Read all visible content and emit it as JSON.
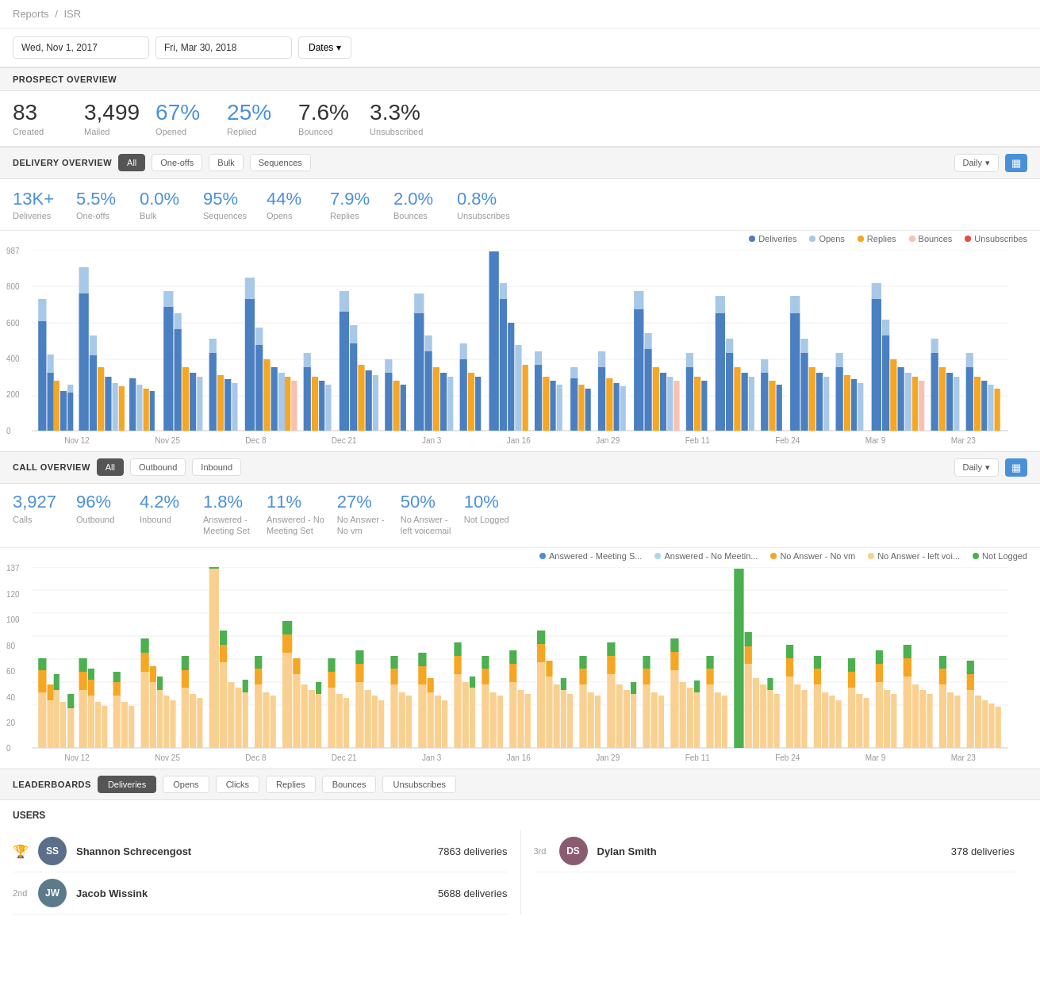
{
  "breadcrumb": {
    "parent": "Reports",
    "separator": "/",
    "current": "ISR"
  },
  "dateRange": {
    "startDate": "Wed, Nov 1, 2017",
    "endDate": "Fri, Mar 30, 2018",
    "datesLabel": "Dates"
  },
  "prospectOverview": {
    "title": "PROSPECT OVERVIEW",
    "metrics": [
      {
        "value": "83",
        "label": "Created"
      },
      {
        "value": "3,499",
        "label": "Mailed"
      },
      {
        "value": "67%",
        "label": "Opened"
      },
      {
        "value": "25%",
        "label": "Replied"
      },
      {
        "value": "7.6%",
        "label": "Bounced"
      },
      {
        "value": "3.3%",
        "label": "Unsubscribed"
      }
    ]
  },
  "deliveryOverview": {
    "title": "DELIVERY OVERVIEW",
    "tabs": [
      "All",
      "One-offs",
      "Bulk",
      "Sequences"
    ],
    "activeTab": "All",
    "timeFilter": "Daily",
    "metrics": [
      {
        "value": "13K+",
        "label": "Deliveries"
      },
      {
        "value": "5.5%",
        "label": "One-offs"
      },
      {
        "value": "0.0%",
        "label": "Bulk"
      },
      {
        "value": "95%",
        "label": "Sequences"
      },
      {
        "value": "44%",
        "label": "Opens"
      },
      {
        "value": "7.9%",
        "label": "Replies"
      },
      {
        "value": "2.0%",
        "label": "Bounces"
      },
      {
        "value": "0.8%",
        "label": "Unsubscribes"
      }
    ],
    "legend": [
      {
        "label": "Deliveries",
        "color": "#4a7fc1"
      },
      {
        "label": "Opens",
        "color": "#a8c8e8"
      },
      {
        "label": "Replies",
        "color": "#f5a623"
      },
      {
        "label": "Bounces",
        "color": "#f9d0c0"
      },
      {
        "label": "Unsubscribes",
        "color": "#e74c3c"
      }
    ],
    "xLabels": [
      "Nov 12",
      "Nov 25",
      "Dec 8",
      "Dec 21",
      "Jan 3",
      "Jan 16",
      "Jan 29",
      "Feb 11",
      "Feb 24",
      "Mar 9",
      "Mar 23"
    ],
    "yMax": 987,
    "yLabels": [
      "987",
      "800",
      "600",
      "400",
      "200",
      "0"
    ]
  },
  "callOverview": {
    "title": "CALL OVERVIEW",
    "tabs": [
      "All",
      "Outbound",
      "Inbound"
    ],
    "activeTab": "All",
    "timeFilter": "Daily",
    "metrics": [
      {
        "value": "3,927",
        "label": "Calls"
      },
      {
        "value": "96%",
        "label": "Outbound"
      },
      {
        "value": "4.2%",
        "label": "Inbound"
      },
      {
        "value": "1.8%",
        "label": "Answered -\nMeeting Set"
      },
      {
        "value": "11%",
        "label": "Answered - No\nMeeting Set"
      },
      {
        "value": "27%",
        "label": "No Answer -\nNo vm"
      },
      {
        "value": "50%",
        "label": "No Answer -\nleft voicemail"
      },
      {
        "value": "10%",
        "label": "Not Logged"
      }
    ],
    "legend": [
      {
        "label": "Answered - Meeting S...",
        "color": "#4a90d9"
      },
      {
        "label": "Answered - No Meetin...",
        "color": "#a8d8f0"
      },
      {
        "label": "No Answer - No vm",
        "color": "#f5a623"
      },
      {
        "label": "No Answer - left voi...",
        "color": "#f9d090"
      },
      {
        "label": "Not Logged",
        "color": "#4caf50"
      }
    ],
    "xLabels": [
      "Nov 12",
      "Nov 25",
      "Dec 8",
      "Dec 21",
      "Jan 3",
      "Jan 16",
      "Jan 29",
      "Feb 11",
      "Feb 24",
      "Mar 9",
      "Mar 23"
    ],
    "yMax": 137,
    "yLabels": [
      "137",
      "120",
      "100",
      "80",
      "60",
      "40",
      "20",
      "0"
    ]
  },
  "leaderboards": {
    "title": "LEADERBOARDS",
    "tabs": [
      "Deliveries",
      "Opens",
      "Clicks",
      "Replies",
      "Bounces",
      "Unsubscribes"
    ],
    "activeTab": "Deliveries",
    "usersTitle": "USERS",
    "users": [
      {
        "rank": "1st",
        "initials": "SS",
        "name": "Shannon Schrecengost",
        "value": "7863 deliveries",
        "avatarColor": "#5b6e8a",
        "trophy": true
      },
      {
        "rank": "2nd",
        "initials": "JW",
        "name": "Jacob Wissink",
        "value": "5688 deliveries",
        "avatarColor": "#5b7a8a",
        "trophy": false
      },
      {
        "rank": "3rd",
        "initials": "DS",
        "name": "Dylan Smith",
        "value": "378 deliveries",
        "avatarColor": "#8a5b6e",
        "trophy": false
      }
    ]
  },
  "icons": {
    "chevronDown": "▾",
    "barChart": "▦",
    "trophy": "🏆"
  }
}
